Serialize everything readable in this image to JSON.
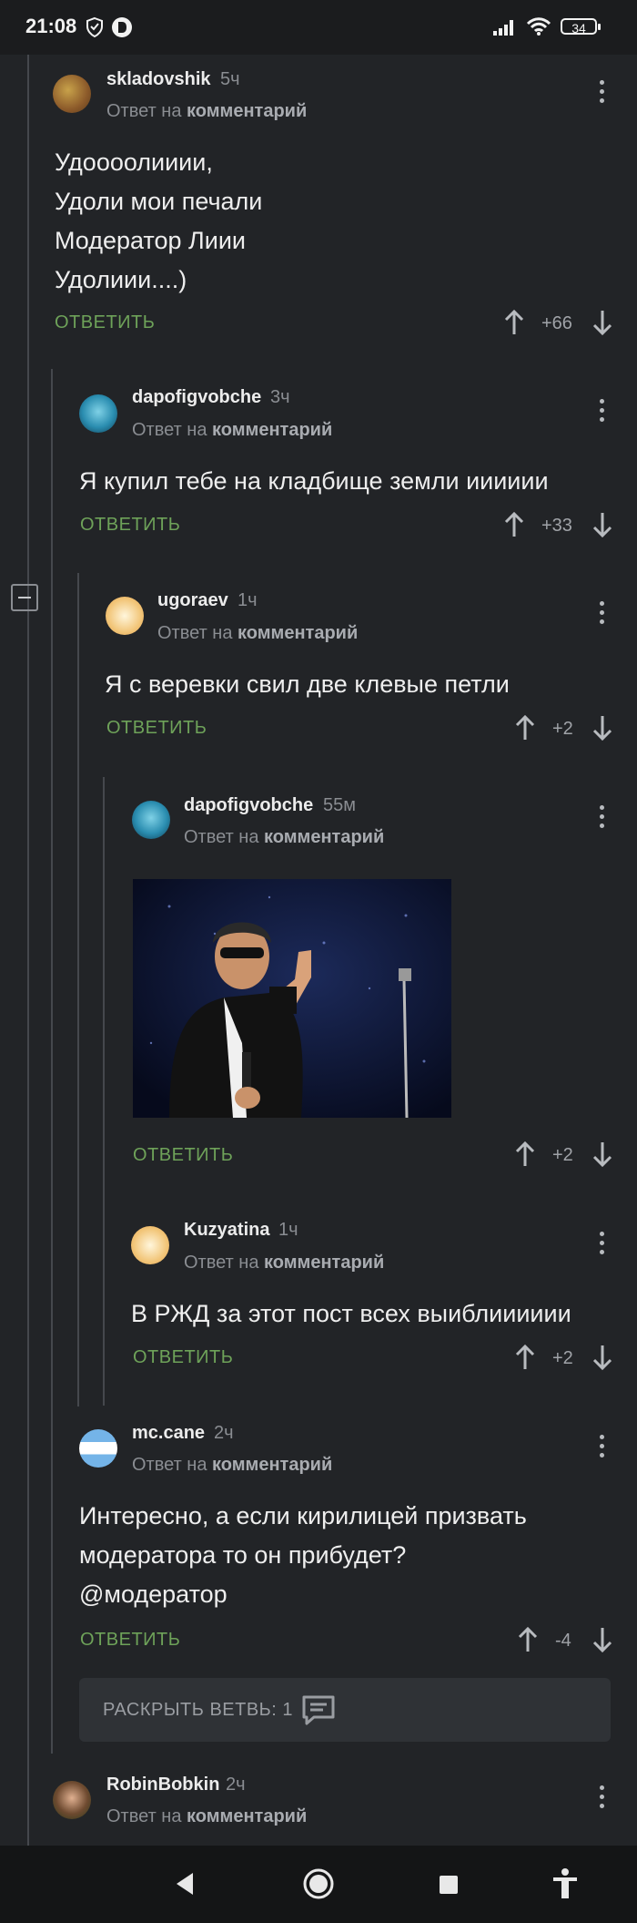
{
  "status_bar": {
    "time": "21:08",
    "battery": "34"
  },
  "comments": [
    {
      "username": "skladovshik",
      "ago": "5ч",
      "reply_prefix": "Ответ на",
      "reply_target": "комментарий",
      "lines": [
        "Удоооолииии,",
        "Удоли мои печали",
        "Модератор Лиии",
        "Удолиии....)"
      ],
      "score": "+66",
      "reply_label": "ОТВЕТИТЬ"
    },
    {
      "username": "dapofigvobche",
      "ago": "3ч",
      "reply_prefix": "Ответ на",
      "reply_target": "комментарий",
      "lines": [
        "Я купил тебе на кладбище земли ииииии"
      ],
      "score": "+33",
      "reply_label": "ОТВЕТИТЬ"
    },
    {
      "username": "ugoraev",
      "ago": "1ч",
      "reply_prefix": "Ответ на",
      "reply_target": "комментарий",
      "lines": [
        "Я с веревки свил две клевые петли"
      ],
      "score": "+2",
      "reply_label": "ОТВЕТИТЬ"
    },
    {
      "username": "dapofigvobche",
      "ago": "55м",
      "reply_prefix": "Ответ на",
      "reply_target": "комментарий",
      "lines": [],
      "has_image": true,
      "score": "+2",
      "reply_label": "ОТВЕТИТЬ"
    },
    {
      "username": "Kuzyatina",
      "ago": "1ч",
      "reply_prefix": "Ответ на",
      "reply_target": "комментарий",
      "lines": [
        "В РЖД за этот пост всех выиблииииии"
      ],
      "score": "+2",
      "reply_label": "ОТВЕТИТЬ"
    },
    {
      "username": "mc.cane",
      "ago": "2ч",
      "reply_prefix": "Ответ на",
      "reply_target": "комментарий",
      "lines": [
        "Интересно, а если кирилицей призвать",
        "модератора то он прибудет?",
        "@модератор"
      ],
      "score": "-4",
      "reply_label": "ОТВЕТИТЬ"
    },
    {
      "username": "RobinBobkin",
      "ago": "2ч",
      "reply_prefix": "Ответ на",
      "reply_target": "комментарий",
      "lines": []
    }
  ],
  "expand_branch": {
    "label": "РАСКРЫТЬ ВЕТВЬ: 1"
  },
  "icons": [
    "shield-icon",
    "d-badge-icon",
    "signal-icon",
    "wifi-icon",
    "battery-icon",
    "upvote-icon",
    "downvote-icon",
    "more-icon",
    "collapse-icon",
    "comments-icon",
    "back-icon",
    "home-icon",
    "recents-icon",
    "accessibility-icon"
  ],
  "colors": {
    "background": "#222427",
    "accent_green": "#6ea259",
    "text": "#eeeeee",
    "muted": "#8a8d92"
  }
}
